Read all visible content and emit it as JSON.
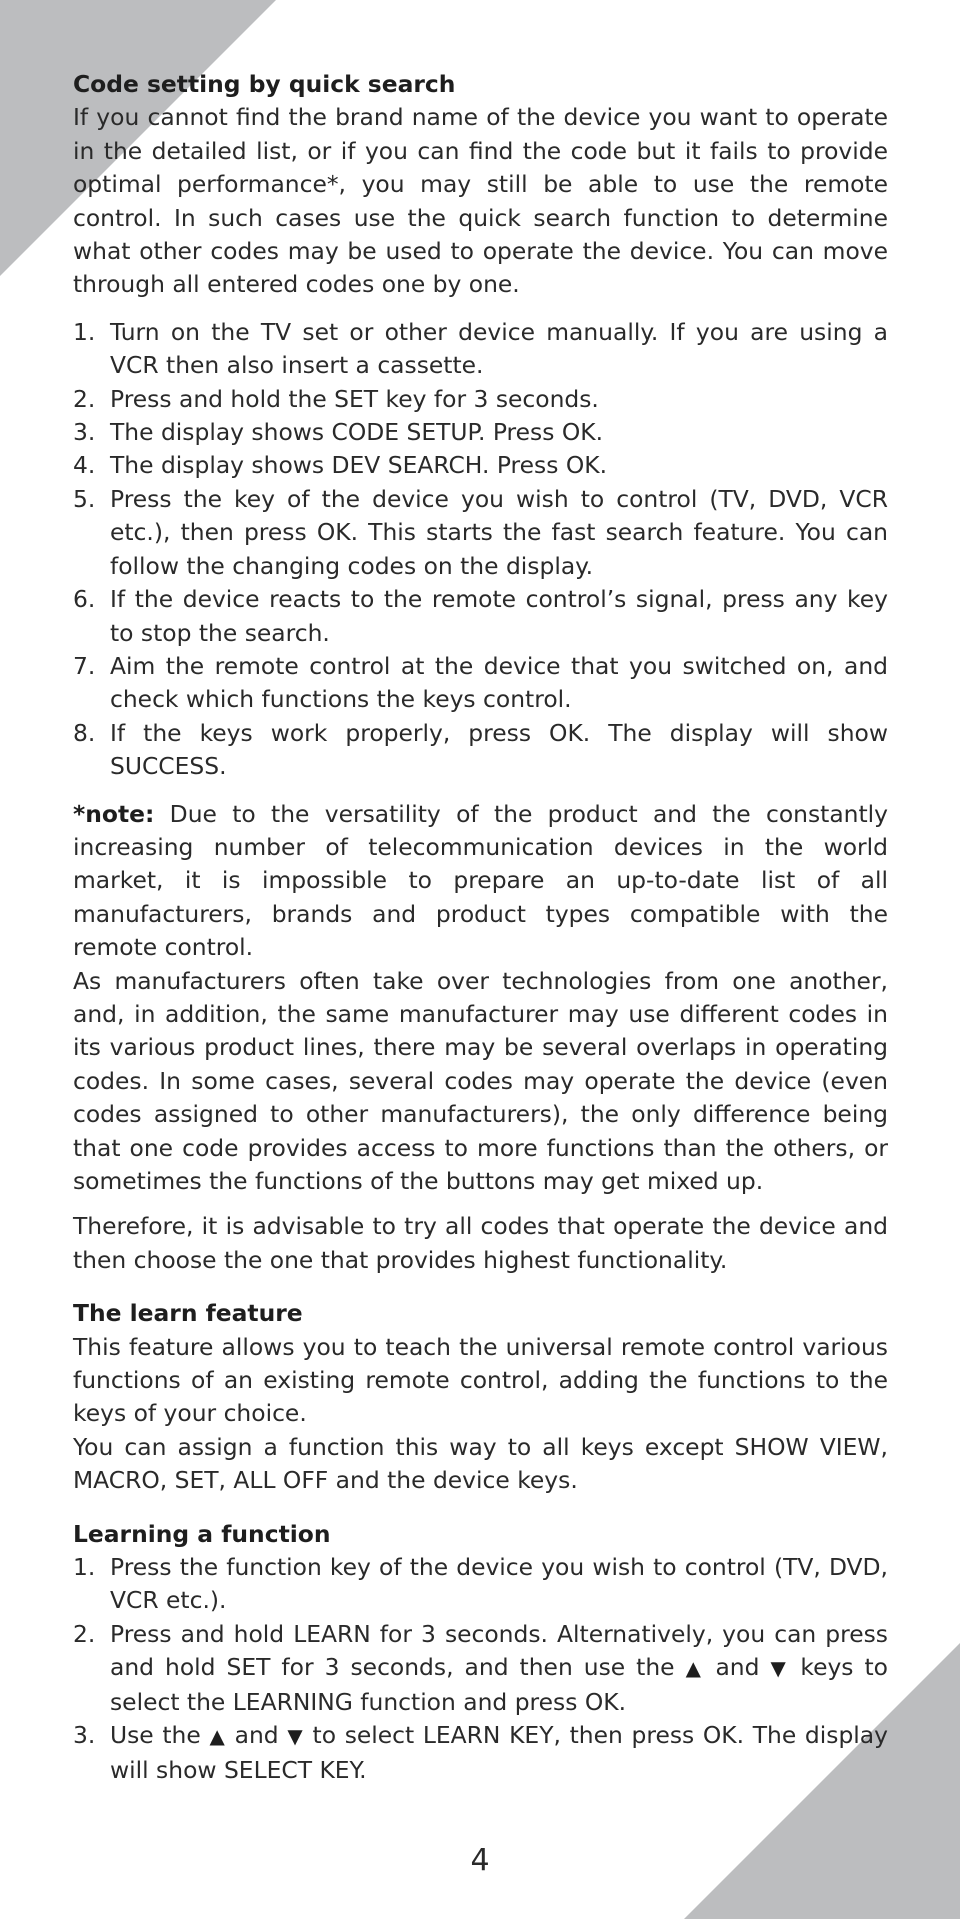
{
  "decoration": {
    "corner_color": "#BCBDBF",
    "text_color": "#2A2A2A"
  },
  "section_quick_search": {
    "heading": "Code setting by quick search",
    "intro": "If you cannot find the brand name of the device you want to operate in the detailed list, or if you can find the code but it fails to provide optimal performance*, you may still be able to use the remote control. In such cases use the quick search function to determine what other codes may be used to operate the device. You can move through all entered codes one by one.",
    "steps": [
      {
        "num": "1.",
        "text": "Turn on the TV set or other device manually. If you are using a VCR then also insert a cassette."
      },
      {
        "num": "2.",
        "text": "Press and hold the SET key for 3 seconds."
      },
      {
        "num": "3.",
        "text": "The display shows CODE SETUP. Press OK."
      },
      {
        "num": "4.",
        "text": "The display shows DEV SEARCH. Press OK."
      },
      {
        "num": "5.",
        "text": "Press the key of the device you wish to control (TV, DVD, VCR etc.), then press OK. This starts the fast search feature. You can follow the changing codes on the display."
      },
      {
        "num": "6.",
        "text": "If the device reacts to the remote control’s signal, press any key to stop the search."
      },
      {
        "num": "7.",
        "text": "Aim the remote control at the device that you switched on, and check which functions the keys control."
      },
      {
        "num": "8.",
        "text": "If the keys work properly, press OK. The display will show SUCCESS."
      }
    ]
  },
  "note": {
    "label": "*note:",
    "text": " Due to the versatility of the product and the constantly increasing number of telecommunication devices in the world market, it is impossible to prepare an up-to-date list of all manufacturers, brands and product types compatible with the remote control.",
    "paragraph2": "As manufacturers often take over technologies from one another, and, in addition,  the same manufacturer may use different codes in its various product lines, there may be several overlaps in operating codes. In some cases, several codes may operate the device (even codes assigned to other manufacturers), the only difference being that one code provides access to more functions than the others, or sometimes the functions of the buttons may get mixed up.",
    "paragraph3": "Therefore, it is advisable to try all codes that operate the device and then choose the one that provides highest functionality."
  },
  "section_learn": {
    "heading": "The learn feature",
    "paragraph1": "This feature allows you to teach the universal remote control various functions of an existing remote control, adding the functions to the keys of your choice.",
    "paragraph2": "You can assign a function this way to all keys except SHOW VIEW, MACRO, SET, ALL OFF and the device keys."
  },
  "section_learning_function": {
    "heading": "Learning a function",
    "up_arrow": "▲",
    "down_arrow": "▼",
    "step1": {
      "num": "1.",
      "text": "Press the function key of the device you wish to control (TV, DVD, VCR etc.)."
    },
    "step2": {
      "num": "2.",
      "text_a": "Press and hold LEARN for 3 seconds. Alternatively, you can press and hold SET for 3 seconds, and then use the ",
      "text_b": " and ",
      "text_c": " keys to select the LEARNING function and press OK."
    },
    "step3": {
      "num": "3.",
      "text_a": "Use the ",
      "text_b": " and ",
      "text_c": " to select LEARN KEY, then press OK. The display will show SELECT KEY."
    }
  },
  "footer": {
    "page_number": "4"
  }
}
